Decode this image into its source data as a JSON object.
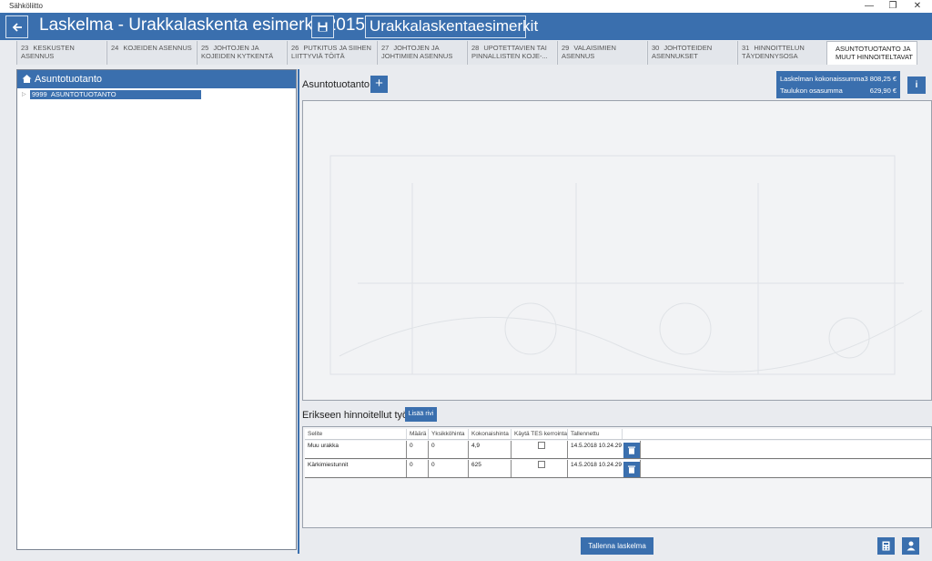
{
  "os": {
    "title": "Sähköliitto",
    "minimize": "—",
    "restore": "❐",
    "close": "✕"
  },
  "header": {
    "back_icon": "arrow-left-icon",
    "title": "Laskelma - Urakkalaskenta esimerkit 2015",
    "save_icon": "floppy-icon",
    "calculation_name": "Urakkalaskentaesimerkit"
  },
  "tabs": [
    {
      "num": "23",
      "label": "KESKUSTEN ASENNUS"
    },
    {
      "num": "24",
      "label": "KOJEIDEN ASENNUS"
    },
    {
      "num": "25",
      "label": "JOHTOJEN JA KOJEIDEN KYTKENTÄ"
    },
    {
      "num": "26",
      "label": "PUTKITUS JA SIIHEN LIITTYVIÄ TÖITÄ"
    },
    {
      "num": "27",
      "label": "JOHTOJEN JA JOHTIMIEN ASENNUS"
    },
    {
      "num": "28",
      "label": "UPOTETTAVIEN TAI PINNALLISTEN KOJE-..."
    },
    {
      "num": "29",
      "label": "VALAISIMIEN ASENNUS"
    },
    {
      "num": "30",
      "label": "JOHTOTEIDEN ASENNUKSET"
    },
    {
      "num": "31",
      "label": "HINNOITTELUN TÄYDENNYSOSA"
    },
    {
      "num": "",
      "label": "ASUNTOTUOTANTO JA MUUT HINNOITELTAVAT"
    }
  ],
  "left_panel": {
    "icon": "home-icon",
    "title": "Asuntotuotanto",
    "tree": [
      {
        "code": "9999",
        "label": "ASUNTOTUOTANTO"
      }
    ]
  },
  "main": {
    "section_title": "Asuntotuotanto",
    "add_label": "+",
    "info_label": "i",
    "summary": {
      "total_label": "Laskelman kokonaissumma",
      "total_value": "3 808,25 €",
      "part_label": "Taulukon osasumma",
      "part_value": "629,90 €"
    }
  },
  "separately_priced": {
    "title": "Erikseen hinnoitellut työt",
    "add_row": "Lisää rivi",
    "columns": [
      "Selite",
      "Määrä",
      "Yksikköhinta",
      "Kokonaishinta",
      "Käytä TES kerrointa",
      "Tallennettu"
    ],
    "rows": [
      {
        "selite": "Muu urakka",
        "maara": "0",
        "yksikkohinta": "0",
        "kokonaishinta": "4,9",
        "tes": false,
        "tallennettu": "14.5.2018 10.24.29"
      },
      {
        "selite": "Kärkimiestunnit",
        "maara": "0",
        "yksikkohinta": "0",
        "kokonaishinta": "625",
        "tes": false,
        "tallennettu": "14.5.2018 10.24.29"
      }
    ]
  },
  "footer": {
    "save_label": "Tallenna laskelma",
    "calculator_icon": "calculator-icon",
    "user_icon": "user-icon"
  },
  "colors": {
    "accent": "#3a6fae",
    "background": "#e9ebef"
  }
}
